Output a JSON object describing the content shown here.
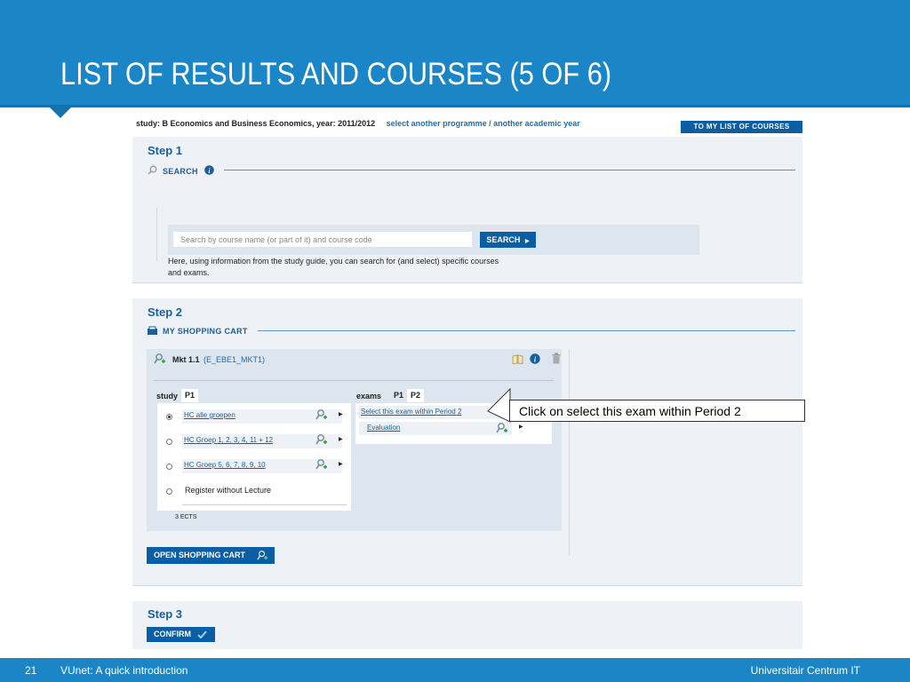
{
  "slide": {
    "title": "LIST OF RESULTS AND COURSES  (5 OF 6)",
    "page_number": "21",
    "footer_text": "VUnet: A quick introduction",
    "footer_org": "Universitair Centrum IT",
    "colors": {
      "header_blue": "#1a86c8",
      "button_blue": "#0b5ea3",
      "link_blue": "#1a6fb0",
      "panel_bg": "#eef2f7"
    }
  },
  "app": {
    "study_line": "study: B Economics and Business Economics, year: 2011/2012",
    "study_link": "select another programme / another academic year",
    "to_list_button": "TO MY LIST OF COURSES",
    "step1": {
      "title": "Step 1",
      "section": "SEARCH",
      "search_placeholder": "Search by course name (or part of it) and course code",
      "search_button": "SEARCH",
      "help_text": "Here, using information from the study guide, you can search for (and select) specific courses and exams."
    },
    "step2": {
      "title": "Step 2",
      "section": "MY SHOPPING CART",
      "course_name": "Mkt 1.1",
      "course_code": "(E_EBE1_MKT1)",
      "study_label": "study",
      "study_tabs": [
        "P1"
      ],
      "exams_label": "exams",
      "exam_tabs": [
        "P1",
        "P2"
      ],
      "groups": [
        {
          "label": "HC alle groepen",
          "selected": true
        },
        {
          "label": "HC Groep 1, 2, 3, 4, 11 + 12",
          "selected": false
        },
        {
          "label": "HC Groep 5, 6, 7, 8, 9, 10",
          "selected": false
        },
        {
          "label": "Register without Lecture",
          "selected": false
        }
      ],
      "exam_links": [
        "Select this exam within Period 2",
        "Evaluation"
      ],
      "ects": "3 ECTS",
      "open_cart_button": "OPEN SHOPPING CART"
    },
    "step3": {
      "title": "Step 3",
      "confirm_button": "CONFIRM"
    }
  },
  "callout": {
    "text": "Click on select this exam within Period 2"
  },
  "icons": [
    "search-icon",
    "info-icon",
    "cart-icon",
    "person-add-icon",
    "book-icon",
    "trash-icon",
    "checkmark-icon",
    "triangle-right-icon"
  ]
}
